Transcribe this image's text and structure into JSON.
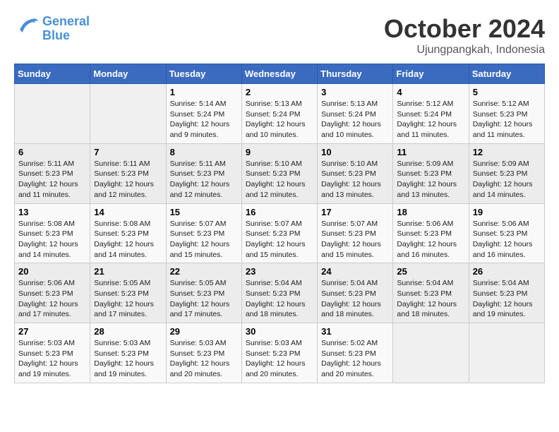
{
  "logo": {
    "line1": "General",
    "line2": "Blue"
  },
  "title": "October 2024",
  "location": "Ujungpangkah, Indonesia",
  "days_header": [
    "Sunday",
    "Monday",
    "Tuesday",
    "Wednesday",
    "Thursday",
    "Friday",
    "Saturday"
  ],
  "weeks": [
    [
      {
        "num": "",
        "info": ""
      },
      {
        "num": "",
        "info": ""
      },
      {
        "num": "1",
        "info": "Sunrise: 5:14 AM\nSunset: 5:24 PM\nDaylight: 12 hours\nand 9 minutes."
      },
      {
        "num": "2",
        "info": "Sunrise: 5:13 AM\nSunset: 5:24 PM\nDaylight: 12 hours\nand 10 minutes."
      },
      {
        "num": "3",
        "info": "Sunrise: 5:13 AM\nSunset: 5:24 PM\nDaylight: 12 hours\nand 10 minutes."
      },
      {
        "num": "4",
        "info": "Sunrise: 5:12 AM\nSunset: 5:24 PM\nDaylight: 12 hours\nand 11 minutes."
      },
      {
        "num": "5",
        "info": "Sunrise: 5:12 AM\nSunset: 5:23 PM\nDaylight: 12 hours\nand 11 minutes."
      }
    ],
    [
      {
        "num": "6",
        "info": "Sunrise: 5:11 AM\nSunset: 5:23 PM\nDaylight: 12 hours\nand 11 minutes."
      },
      {
        "num": "7",
        "info": "Sunrise: 5:11 AM\nSunset: 5:23 PM\nDaylight: 12 hours\nand 12 minutes."
      },
      {
        "num": "8",
        "info": "Sunrise: 5:11 AM\nSunset: 5:23 PM\nDaylight: 12 hours\nand 12 minutes."
      },
      {
        "num": "9",
        "info": "Sunrise: 5:10 AM\nSunset: 5:23 PM\nDaylight: 12 hours\nand 12 minutes."
      },
      {
        "num": "10",
        "info": "Sunrise: 5:10 AM\nSunset: 5:23 PM\nDaylight: 12 hours\nand 13 minutes."
      },
      {
        "num": "11",
        "info": "Sunrise: 5:09 AM\nSunset: 5:23 PM\nDaylight: 12 hours\nand 13 minutes."
      },
      {
        "num": "12",
        "info": "Sunrise: 5:09 AM\nSunset: 5:23 PM\nDaylight: 12 hours\nand 14 minutes."
      }
    ],
    [
      {
        "num": "13",
        "info": "Sunrise: 5:08 AM\nSunset: 5:23 PM\nDaylight: 12 hours\nand 14 minutes."
      },
      {
        "num": "14",
        "info": "Sunrise: 5:08 AM\nSunset: 5:23 PM\nDaylight: 12 hours\nand 14 minutes."
      },
      {
        "num": "15",
        "info": "Sunrise: 5:07 AM\nSunset: 5:23 PM\nDaylight: 12 hours\nand 15 minutes."
      },
      {
        "num": "16",
        "info": "Sunrise: 5:07 AM\nSunset: 5:23 PM\nDaylight: 12 hours\nand 15 minutes."
      },
      {
        "num": "17",
        "info": "Sunrise: 5:07 AM\nSunset: 5:23 PM\nDaylight: 12 hours\nand 15 minutes."
      },
      {
        "num": "18",
        "info": "Sunrise: 5:06 AM\nSunset: 5:23 PM\nDaylight: 12 hours\nand 16 minutes."
      },
      {
        "num": "19",
        "info": "Sunrise: 5:06 AM\nSunset: 5:23 PM\nDaylight: 12 hours\nand 16 minutes."
      }
    ],
    [
      {
        "num": "20",
        "info": "Sunrise: 5:06 AM\nSunset: 5:23 PM\nDaylight: 12 hours\nand 17 minutes."
      },
      {
        "num": "21",
        "info": "Sunrise: 5:05 AM\nSunset: 5:23 PM\nDaylight: 12 hours\nand 17 minutes."
      },
      {
        "num": "22",
        "info": "Sunrise: 5:05 AM\nSunset: 5:23 PM\nDaylight: 12 hours\nand 17 minutes."
      },
      {
        "num": "23",
        "info": "Sunrise: 5:04 AM\nSunset: 5:23 PM\nDaylight: 12 hours\nand 18 minutes."
      },
      {
        "num": "24",
        "info": "Sunrise: 5:04 AM\nSunset: 5:23 PM\nDaylight: 12 hours\nand 18 minutes."
      },
      {
        "num": "25",
        "info": "Sunrise: 5:04 AM\nSunset: 5:23 PM\nDaylight: 12 hours\nand 18 minutes."
      },
      {
        "num": "26",
        "info": "Sunrise: 5:04 AM\nSunset: 5:23 PM\nDaylight: 12 hours\nand 19 minutes."
      }
    ],
    [
      {
        "num": "27",
        "info": "Sunrise: 5:03 AM\nSunset: 5:23 PM\nDaylight: 12 hours\nand 19 minutes."
      },
      {
        "num": "28",
        "info": "Sunrise: 5:03 AM\nSunset: 5:23 PM\nDaylight: 12 hours\nand 19 minutes."
      },
      {
        "num": "29",
        "info": "Sunrise: 5:03 AM\nSunset: 5:23 PM\nDaylight: 12 hours\nand 20 minutes."
      },
      {
        "num": "30",
        "info": "Sunrise: 5:03 AM\nSunset: 5:23 PM\nDaylight: 12 hours\nand 20 minutes."
      },
      {
        "num": "31",
        "info": "Sunrise: 5:02 AM\nSunset: 5:23 PM\nDaylight: 12 hours\nand 20 minutes."
      },
      {
        "num": "",
        "info": ""
      },
      {
        "num": "",
        "info": ""
      }
    ]
  ]
}
